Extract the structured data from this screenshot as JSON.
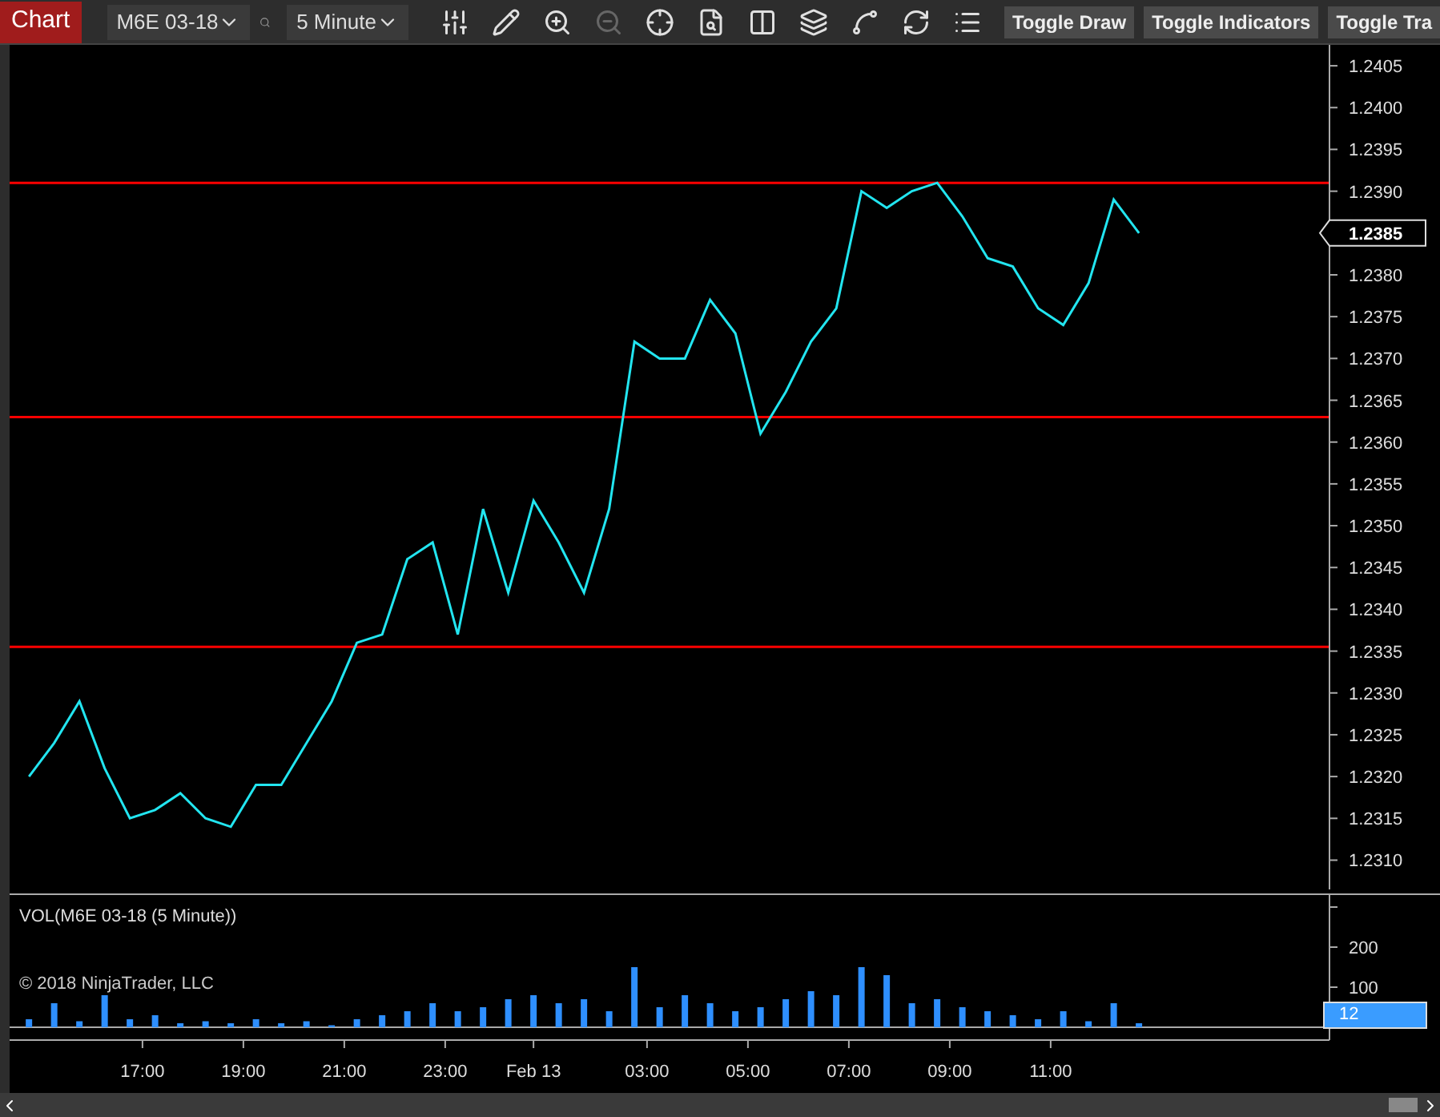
{
  "toolbar": {
    "chart_tab": {
      "label": "Chart"
    },
    "instrument": {
      "value": "M6E 03-18"
    },
    "interval": {
      "value": "5 Minute"
    },
    "tools": [
      {
        "kind": "bars",
        "disabled": false
      },
      {
        "kind": "pencil",
        "disabled": false
      },
      {
        "kind": "zoom-in",
        "disabled": false
      },
      {
        "kind": "zoom-out",
        "disabled": true
      },
      {
        "kind": "crosshair",
        "disabled": false
      },
      {
        "kind": "data-box",
        "disabled": false
      },
      {
        "kind": "split",
        "disabled": false
      },
      {
        "kind": "layers",
        "disabled": false
      },
      {
        "kind": "spline",
        "disabled": false
      },
      {
        "kind": "refresh",
        "disabled": false
      },
      {
        "kind": "list",
        "disabled": false
      }
    ],
    "buttons": [
      "Toggle Draw",
      "Toggle Indicators",
      "Toggle Tra"
    ]
  },
  "price_panel": {
    "current_price": "1.2385",
    "chart_data": {
      "type": "line",
      "ylim": [
        1.23065,
        1.24075
      ],
      "xlim": [
        "2018-02-12T14:22",
        "2018-02-13T18:43"
      ],
      "yticks": [
        {
          "value": 1.231,
          "label": "1.2310"
        },
        1.2315,
        {
          "value": 1.232,
          "label": "1.2320"
        },
        1.2325,
        {
          "value": 1.233,
          "label": "1.2330"
        },
        1.2335,
        {
          "value": 1.234,
          "label": "1.2340"
        },
        1.2345,
        {
          "value": 1.235,
          "label": "1.2350"
        },
        1.2355,
        {
          "value": 1.236,
          "label": "1.2360"
        },
        1.2365,
        {
          "value": 1.237,
          "label": "1.2370"
        },
        1.2375,
        {
          "value": 1.238,
          "label": "1.2380"
        },
        1.2385,
        {
          "value": 1.239,
          "label": "1.2390"
        },
        1.2395,
        {
          "value": 1.24,
          "label": "1.2400"
        },
        1.2405
      ],
      "x": [
        "2018-02-12T14:45",
        "2018-02-12T15:15",
        "2018-02-12T15:45",
        "2018-02-12T16:15",
        "2018-02-12T16:45",
        "2018-02-12T17:15",
        "2018-02-12T17:45",
        "2018-02-12T18:15",
        "2018-02-12T18:45",
        "2018-02-12T19:15",
        "2018-02-12T19:45",
        "2018-02-12T20:15",
        "2018-02-12T20:45",
        "2018-02-12T21:15",
        "2018-02-12T21:45",
        "2018-02-12T22:15",
        "2018-02-12T22:45",
        "2018-02-12T23:15",
        "2018-02-12T23:45",
        "2018-02-13T00:15",
        "2018-02-13T00:45",
        "2018-02-13T01:15",
        "2018-02-13T01:45",
        "2018-02-13T02:15",
        "2018-02-13T02:45",
        "2018-02-13T03:15",
        "2018-02-13T03:45",
        "2018-02-13T04:15",
        "2018-02-13T04:45",
        "2018-02-13T05:15",
        "2018-02-13T05:45",
        "2018-02-13T06:15",
        "2018-02-13T06:45",
        "2018-02-13T07:15",
        "2018-02-13T07:45",
        "2018-02-13T08:15",
        "2018-02-13T08:45",
        "2018-02-13T09:15",
        "2018-02-13T09:45",
        "2018-02-13T10:15",
        "2018-02-13T10:45",
        "2018-02-13T11:15",
        "2018-02-13T11:45",
        "2018-02-13T12:15",
        "2018-02-13T12:45"
      ],
      "series": [
        {
          "color": "#22e5f0",
          "values": [
            1.232,
            1.2324,
            1.2329,
            1.2321,
            1.2315,
            1.2316,
            1.2318,
            1.2315,
            1.2314,
            1.2319,
            1.2319,
            1.2324,
            1.2329,
            1.2336,
            1.2337,
            1.2346,
            1.2348,
            1.2337,
            1.2352,
            1.2342,
            1.2353,
            1.2348,
            1.2342,
            1.2352,
            1.2372,
            1.237,
            1.237,
            1.2377,
            1.2373,
            1.2361,
            1.2366,
            1.2372,
            1.2376,
            1.239,
            1.2388,
            1.239,
            1.2391,
            1.2387,
            1.2382,
            1.2381,
            1.2376,
            1.2374,
            1.2379,
            1.2389,
            1.2385
          ]
        }
      ],
      "ref_lines": [
        {
          "axis": "y",
          "value": 1.2391
        },
        {
          "axis": "y",
          "value": 1.2363
        },
        {
          "axis": "y",
          "value": 1.23355
        }
      ]
    }
  },
  "volume_panel": {
    "title": "VOL(M6E 03-18 (5 Minute))",
    "copyright": "© 2018 NinjaTrader, LLC",
    "current_volume": "12",
    "chart_data": {
      "type": "bar",
      "ylim": [
        0,
        332
      ],
      "xlim": [
        "2018-02-12T14:22",
        "2018-02-13T18:43"
      ],
      "yticks": [
        100,
        200
      ],
      "xticks": [
        {
          "value": "2018-02-12T17:00",
          "label": "17:00"
        },
        {
          "value": "2018-02-12T19:00",
          "label": "19:00"
        },
        {
          "value": "2018-02-12T21:00",
          "label": "21:00"
        },
        {
          "value": "2018-02-12T23:00",
          "label": "23:00"
        },
        {
          "value": "2018-02-13T00:45",
          "label": "Feb 13"
        },
        {
          "value": "2018-02-13T03:00",
          "label": "03:00"
        },
        {
          "value": "2018-02-13T05:00",
          "label": "05:00"
        },
        {
          "value": "2018-02-13T07:00",
          "label": "07:00"
        },
        {
          "value": "2018-02-13T09:00",
          "label": "09:00"
        },
        {
          "value": "2018-02-13T11:00",
          "label": "11:00"
        }
      ],
      "x": [
        "2018-02-12T14:45",
        "2018-02-12T15:15",
        "2018-02-12T15:45",
        "2018-02-12T16:15",
        "2018-02-12T16:45",
        "2018-02-12T17:15",
        "2018-02-12T17:45",
        "2018-02-12T18:15",
        "2018-02-12T18:45",
        "2018-02-12T19:15",
        "2018-02-12T19:45",
        "2018-02-12T20:15",
        "2018-02-12T20:45",
        "2018-02-12T21:15",
        "2018-02-12T21:45",
        "2018-02-12T22:15",
        "2018-02-12T22:45",
        "2018-02-12T23:15",
        "2018-02-12T23:45",
        "2018-02-13T00:15",
        "2018-02-13T00:45",
        "2018-02-13T01:15",
        "2018-02-13T01:45",
        "2018-02-13T02:15",
        "2018-02-13T02:45",
        "2018-02-13T03:15",
        "2018-02-13T03:45",
        "2018-02-13T04:15",
        "2018-02-13T04:45",
        "2018-02-13T05:15",
        "2018-02-13T05:45",
        "2018-02-13T06:15",
        "2018-02-13T06:45",
        "2018-02-13T07:15",
        "2018-02-13T07:45",
        "2018-02-13T08:15",
        "2018-02-13T08:45",
        "2018-02-13T09:15",
        "2018-02-13T09:45",
        "2018-02-13T10:15",
        "2018-02-13T10:45",
        "2018-02-13T11:15",
        "2018-02-13T11:45",
        "2018-02-13T12:15",
        "2018-02-13T12:45"
      ],
      "series": [
        {
          "color": "#2e8fff",
          "values": [
            20,
            60,
            15,
            80,
            20,
            30,
            10,
            15,
            10,
            20,
            10,
            15,
            5,
            20,
            30,
            40,
            60,
            40,
            50,
            70,
            80,
            60,
            70,
            40,
            150,
            50,
            80,
            60,
            40,
            50,
            70,
            90,
            80,
            150,
            130,
            60,
            70,
            50,
            40,
            30,
            20,
            40,
            15,
            60,
            10
          ]
        }
      ]
    }
  }
}
